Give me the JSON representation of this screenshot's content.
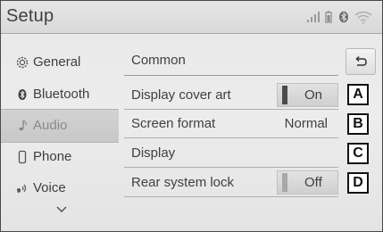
{
  "title": "Setup",
  "status_icons": [
    "signal-icon",
    "battery-icon",
    "bluetooth-status-icon",
    "wifi-icon"
  ],
  "sidebar": {
    "items": [
      {
        "label": "General",
        "icon": "gear-icon"
      },
      {
        "label": "Bluetooth",
        "icon": "bluetooth-icon"
      },
      {
        "label": "Audio",
        "icon": "music-note-icon",
        "active": true
      },
      {
        "label": "Phone",
        "icon": "phone-icon"
      },
      {
        "label": "Voice",
        "icon": "voice-icon"
      }
    ],
    "more_icon": "chevron-down-icon"
  },
  "content": {
    "section_title": "Common",
    "back_icon": "back-arrow-icon",
    "rows": [
      {
        "label": "Display cover art",
        "value": "On",
        "type": "toggle",
        "state": "on",
        "callout": "A"
      },
      {
        "label": "Screen format",
        "value": "Normal",
        "type": "value",
        "callout": "B"
      },
      {
        "label": "Display",
        "value": "",
        "type": "link",
        "callout": "C"
      },
      {
        "label": "Rear system lock",
        "value": "Off",
        "type": "toggle",
        "state": "off",
        "callout": "D"
      }
    ]
  }
}
